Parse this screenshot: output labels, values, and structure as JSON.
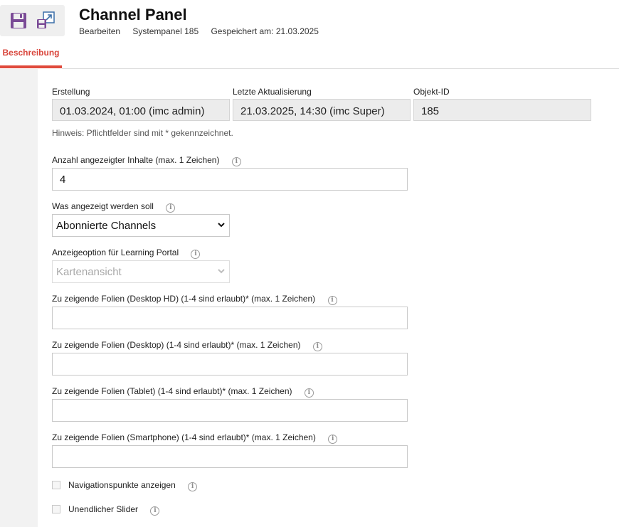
{
  "toolbar": {
    "save_icon": "save-icon",
    "save_as_icon": "save-as-icon"
  },
  "header": {
    "title": "Channel Panel",
    "meta": [
      "Bearbeiten",
      "Systempanel 185",
      "Gespeichert am: 21.03.2025"
    ]
  },
  "tabs": [
    {
      "label": "Beschreibung",
      "active": true
    }
  ],
  "accent_color": "#e04a3c",
  "meta_fields": {
    "created": {
      "label": "Erstellung",
      "value": "01.03.2024, 01:00 (imc admin)"
    },
    "updated": {
      "label": "Letzte Aktualisierung",
      "value": "21.03.2025, 14:30 (imc Super)"
    },
    "object_id": {
      "label": "Objekt-ID",
      "value": "185"
    }
  },
  "hint": "Hinweis: Pflichtfelder sind mit * gekennzeichnet.",
  "fields": {
    "count": {
      "label": "Anzahl angezeigter Inhalte (max. 1 Zeichen)",
      "value": "4"
    },
    "display": {
      "label": "Was angezeigt werden soll",
      "value": "Abonnierte Channels"
    },
    "portal_option": {
      "label": "Anzeigeoption für Learning Portal",
      "value": "Kartenansicht",
      "disabled": true
    },
    "slides_desktop_hd": {
      "label": "Zu zeigende Folien (Desktop HD) (1-4 sind erlaubt)* (max. 1 Zeichen)",
      "value": ""
    },
    "slides_desktop": {
      "label": "Zu zeigende Folien (Desktop) (1-4 sind erlaubt)* (max. 1 Zeichen)",
      "value": ""
    },
    "slides_tablet": {
      "label": "Zu zeigende Folien (Tablet) (1-4 sind erlaubt)* (max. 1 Zeichen)",
      "value": ""
    },
    "slides_smartphone": {
      "label": "Zu zeigende Folien (Smartphone) (1-4 sind erlaubt)* (max. 1 Zeichen)",
      "value": ""
    }
  },
  "checkboxes": {
    "navigation_dots": {
      "label": "Navigationspunkte anzeigen",
      "checked": false
    },
    "infinite_slider": {
      "label": "Unendlicher Slider",
      "checked": false
    }
  },
  "info_glyph": "i"
}
